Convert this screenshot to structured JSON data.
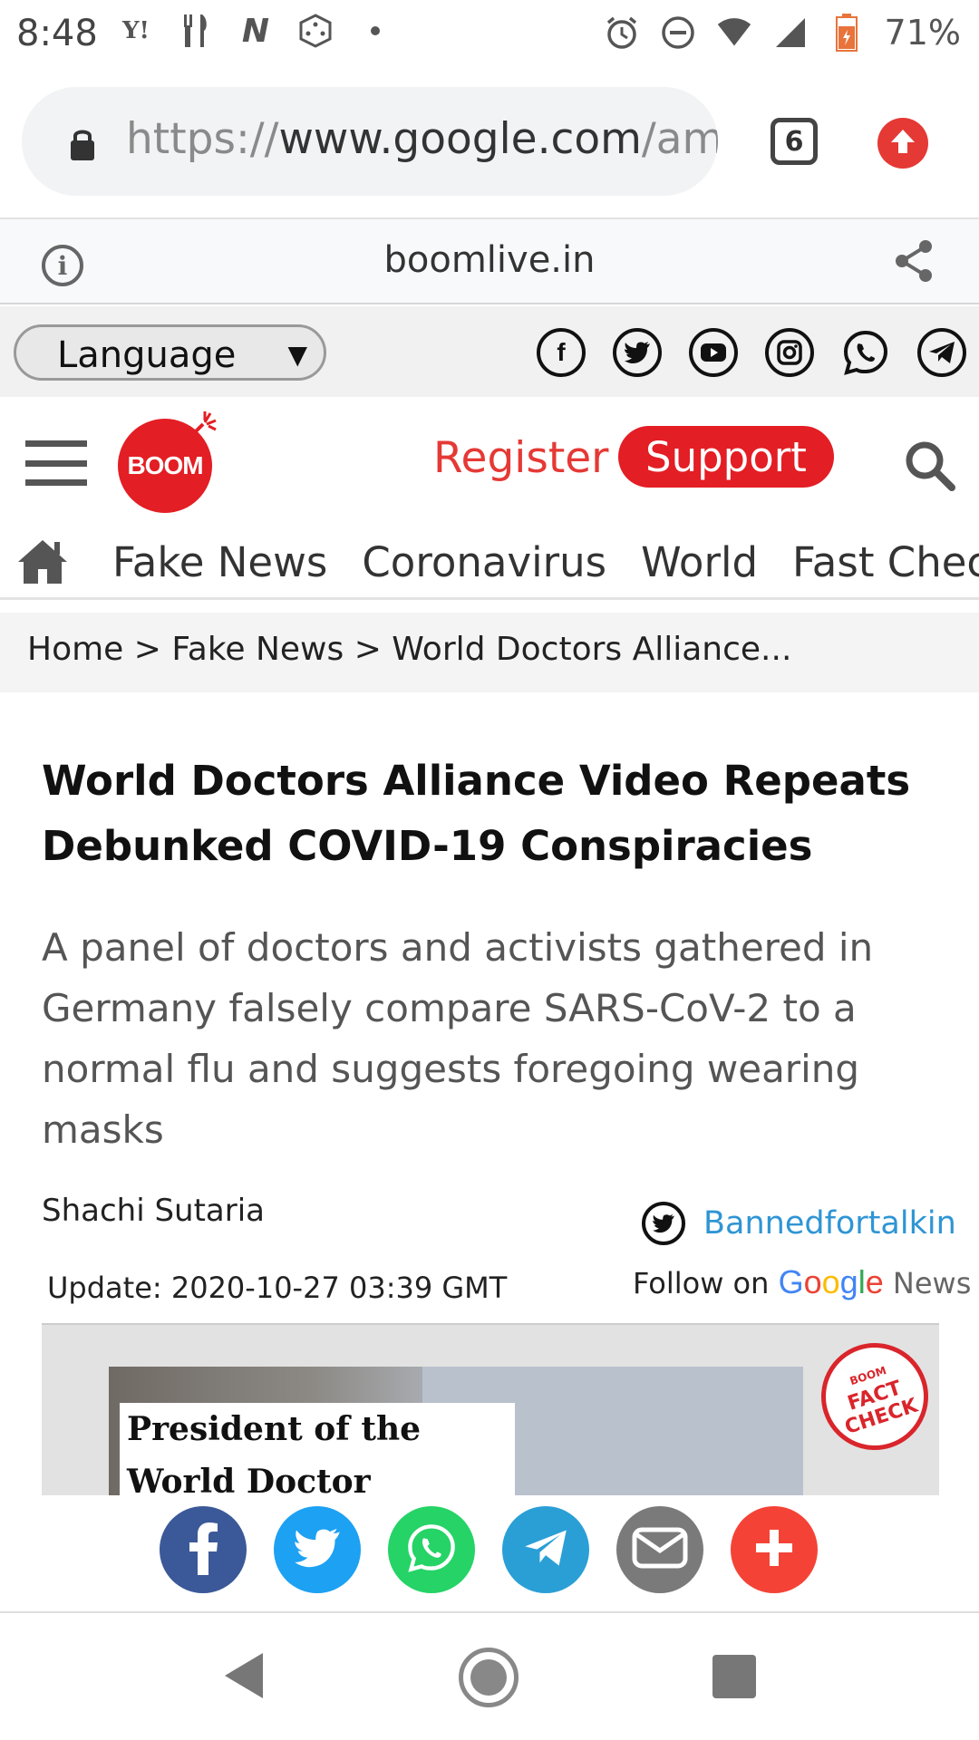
{
  "status_bar": {
    "time": "8:48",
    "left_icons": [
      "yahoo-icon",
      "restaurant-icon",
      "n-icon",
      "dice-icon",
      "dot-icon"
    ],
    "right_icons": [
      "alarm-icon",
      "dnd-icon",
      "wifi-icon",
      "signal-icon",
      "battery-icon"
    ],
    "battery": "71%"
  },
  "browser": {
    "url_scheme": "https://",
    "url_host": "www.google.com",
    "url_path": "/amp",
    "tab_count": "6",
    "domain": "boomlive.in"
  },
  "site_top": {
    "language_label": "Language",
    "language_caret": "▼",
    "socials": [
      "facebook-icon",
      "twitter-icon",
      "youtube-icon",
      "instagram-icon",
      "whatsapp-icon",
      "telegram-icon"
    ]
  },
  "header": {
    "logo_text": "BOOM",
    "register": "Register",
    "support": "Support"
  },
  "nav": {
    "items": [
      "Fake News",
      "Coronavirus",
      "World",
      "Fast Check"
    ]
  },
  "breadcrumb": "Home > Fake News > World Doctors Alliance...",
  "article": {
    "title": "World Doctors Alliance Video Repeats Debunked COVID-19 Conspiracies",
    "summary": "A panel of doctors and activists gathered in Germany falsely compare SARS-CoV-2 to a normal flu and suggests foregoing wearing masks",
    "author": "Shachi Sutaria",
    "twitter_handle": "Bannedfortalkin",
    "update": "Update: 2020-10-27 03:39 GMT",
    "follow_on": "Follow on",
    "google_news_suffix": "News",
    "image_caption": "President of the World Doctor Alliance says",
    "stamp_top": "BOOM",
    "stamp_line1": "FACT",
    "stamp_line2": "CHECK"
  },
  "share_buttons": [
    {
      "name": "facebook-share",
      "color": "#3b5998"
    },
    {
      "name": "twitter-share",
      "color": "#1da1f2"
    },
    {
      "name": "whatsapp-share",
      "color": "#25d366"
    },
    {
      "name": "telegram-share",
      "color": "#2a9fd6"
    },
    {
      "name": "email-share",
      "color": "#7a7a7a"
    },
    {
      "name": "more-share",
      "color": "#f44336"
    }
  ],
  "colors": {
    "brand_red": "#e31e24",
    "link_blue": "#2f95d4"
  }
}
